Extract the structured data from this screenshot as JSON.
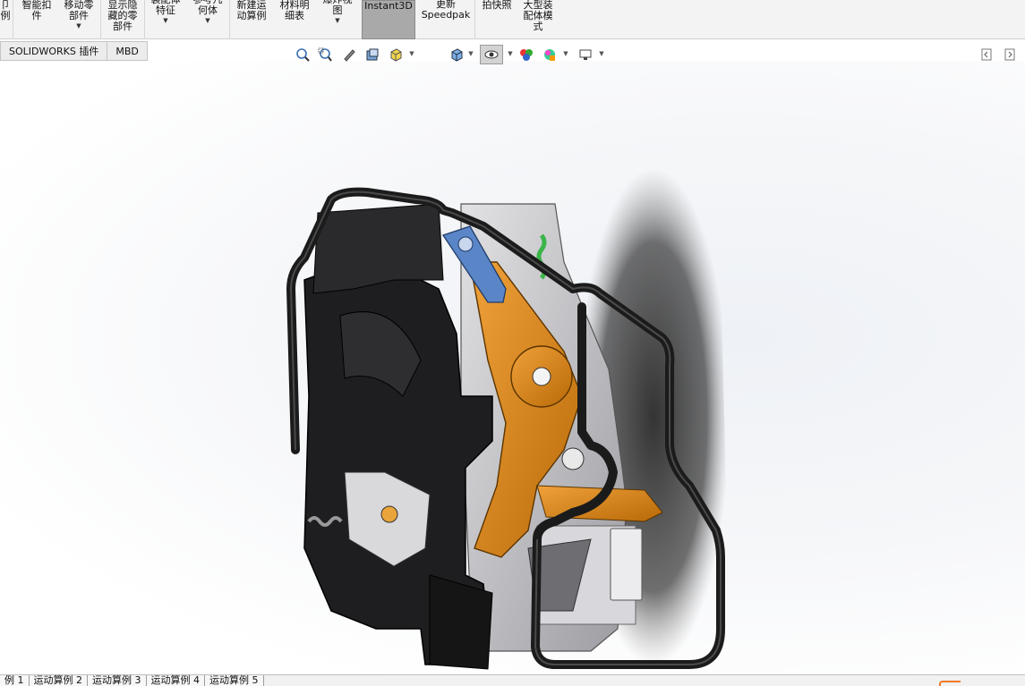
{
  "ribbon": {
    "items": [
      {
        "label": "卩\n例",
        "icon": "partial-icon"
      },
      {
        "label": "智能扣\n件",
        "icon": "smart-fastener-icon"
      },
      {
        "label": "移动零\n部件",
        "icon": "move-component-icon"
      },
      {
        "label": "显示隐\n藏的零\n部件",
        "icon": "show-hidden-icon"
      },
      {
        "label": "装配体\n特征",
        "icon": "assembly-feature-icon"
      },
      {
        "label": "参考几\n何体",
        "icon": "reference-geometry-icon"
      },
      {
        "label": "新建运\n动算例",
        "icon": "new-motion-study-icon"
      },
      {
        "label": "材料明\n细表",
        "icon": "bom-icon"
      },
      {
        "label": "爆炸视\n图",
        "icon": "exploded-view-icon"
      },
      {
        "label": "Instant3D",
        "icon": "instant3d-icon"
      },
      {
        "label": "更新\nSpeedpak",
        "icon": "speedpak-icon"
      },
      {
        "label": "拍快照",
        "icon": "snapshot-icon"
      },
      {
        "label": "大型装\n配体模\n式",
        "icon": "large-assembly-icon"
      }
    ]
  },
  "command_tabs": [
    "SOLIDWORKS 插件",
    "MBD"
  ],
  "hud_icons": [
    "zoom-to-fit-icon",
    "zoom-to-area-icon",
    "previous-view-icon",
    "section-view-icon",
    "view-orientation-icon",
    "display-style-icon",
    "hide-show-items-icon",
    "edit-appearance-icon",
    "apply-scene-icon",
    "view-settings-icon"
  ],
  "bottom_tabs": [
    "例 1",
    "运动算例 2",
    "运动算例 3",
    "运动算例 4",
    "运动算例 5"
  ],
  "colors": {
    "accent_orange": "#d4810f",
    "part_blue": "#5a86c8",
    "frame_black": "#1b1b1b",
    "housing_gray": "#c9c9cc",
    "spring_green": "#3db54a"
  }
}
